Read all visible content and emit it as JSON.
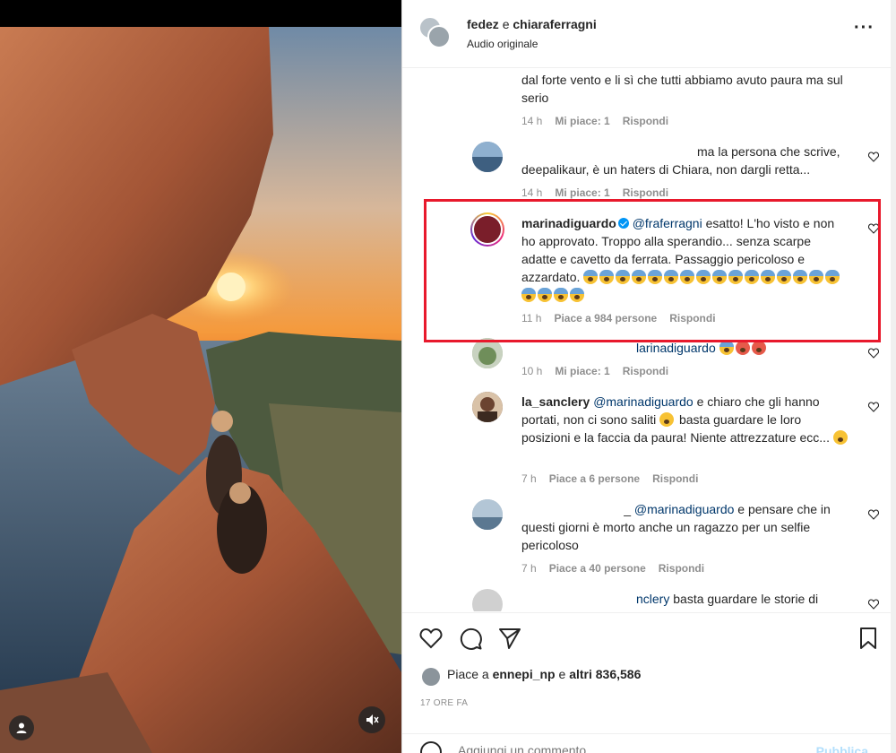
{
  "post": {
    "authors": [
      "fedez",
      "chiaraferragni"
    ],
    "author_joiner": "e",
    "subtitle": "Audio originale"
  },
  "comments": [
    {
      "text": "dal forte vento e li sì che tutti abbiamo avuto paura ma sul serio",
      "time": "14 h",
      "likes": "Mi piace: 1",
      "reply": "Rispondi"
    },
    {
      "text": "ma la persona che scrive, deepalikaur, è un haters di Chiara, non dargli retta...",
      "time": "14 h",
      "likes": "Mi piace: 1",
      "reply": "Rispondi"
    },
    {
      "username": "marinadiguardo",
      "mention": "@fraferragni",
      "text": "esatto! L'ho visto e non ho approvato. Troppo alla sperandio... senza scarpe adatte e cavetto da ferrata. Passaggio pericoloso e azzardato.",
      "time": "11 h",
      "likes": "Piace a 984 persone",
      "reply": "Rispondi"
    },
    {
      "text": "larinadiguardo",
      "time": "10 h",
      "likes": "Mi piace: 1",
      "reply": "Rispondi"
    },
    {
      "username": "la_sanclery",
      "mention": "@marinadiguardo",
      "text_a": "e chiaro che gli hanno portati, non ci sono saliti",
      "text_b": "basta guardare le loro posizioni e la faccia da paura! Niente attrezzature ecc...",
      "time": "7 h",
      "likes": "Piace a 6 persone",
      "reply": "Rispondi"
    },
    {
      "username": "_",
      "mention": "@marinadiguardo",
      "text": "e pensare che in questi giorni è morto anche un ragazzo per un selfie pericoloso",
      "time": "7 h",
      "likes": "Piace a 40 persone",
      "reply": "Rispondi"
    },
    {
      "mention": "nclery",
      "text": "basta guardare le storie di"
    }
  ],
  "footer": {
    "likes_prefix": "Piace a",
    "likes_user": "ennepi_np",
    "likes_join": "e",
    "likes_rest": "altri 836,586",
    "date": "17 ORE FA",
    "add_placeholder": "Aggiungi un commento...",
    "publish_label": "Pubblica"
  },
  "icons": {
    "like": "heart-icon",
    "comment": "comment-icon",
    "share": "send-icon",
    "save": "bookmark-icon",
    "more": "more-icon",
    "mute": "muted-speaker-icon",
    "tags": "user-tag-icon"
  },
  "colors": {
    "highlight_box": "#e8192c",
    "link": "#00376b",
    "meta": "#8e8e8e",
    "publish_disabled": "#b2dffc",
    "verified": "#0095f6"
  }
}
